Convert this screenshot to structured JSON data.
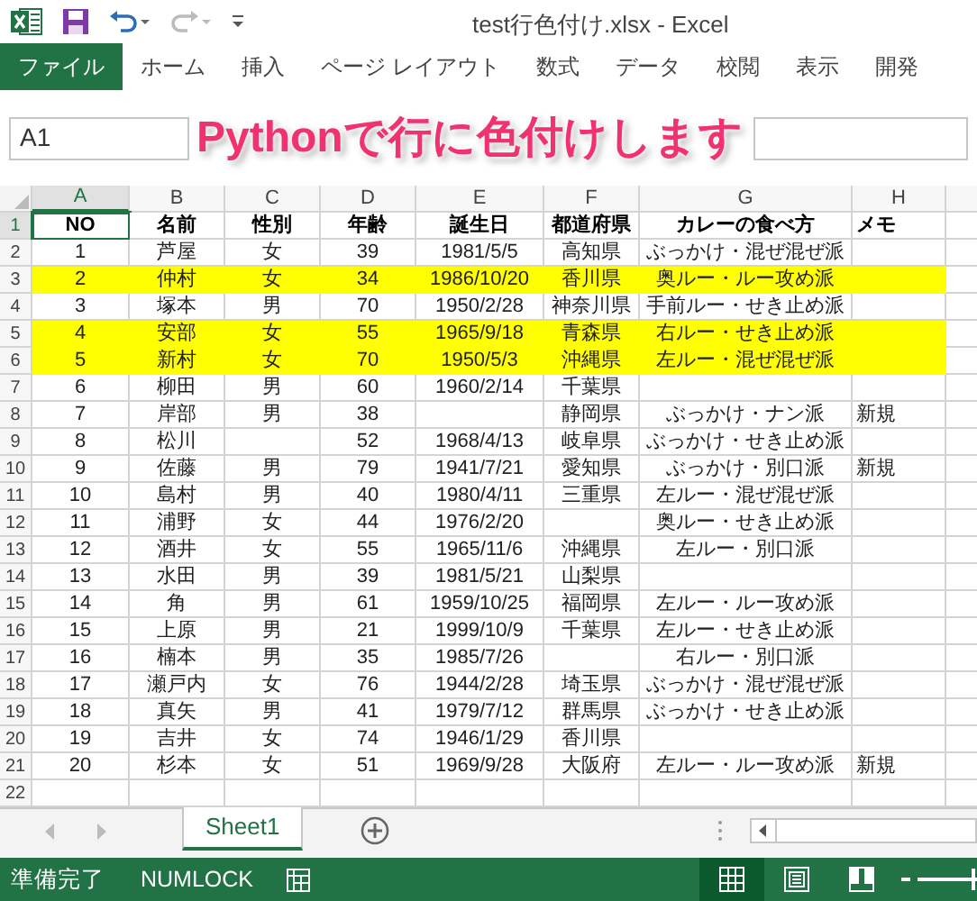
{
  "title_bar": {
    "title": "test行色付け.xlsx - Excel"
  },
  "ribbon_tabs": [
    {
      "label": "ファイル",
      "kind": "file"
    },
    {
      "label": "ホーム",
      "kind": "tab"
    },
    {
      "label": "挿入",
      "kind": "tab"
    },
    {
      "label": "ページ レイアウト",
      "kind": "tab"
    },
    {
      "label": "数式",
      "kind": "tab"
    },
    {
      "label": "データ",
      "kind": "tab"
    },
    {
      "label": "校閲",
      "kind": "tab"
    },
    {
      "label": "表示",
      "kind": "tab"
    },
    {
      "label": "開発",
      "kind": "tab"
    }
  ],
  "name_box": "A1",
  "banner": "Pythonで行に色付けします",
  "columns": [
    {
      "label": "A",
      "selected": true
    },
    {
      "label": "B",
      "selected": false
    },
    {
      "label": "C",
      "selected": false
    },
    {
      "label": "D",
      "selected": false
    },
    {
      "label": "E",
      "selected": false
    },
    {
      "label": "F",
      "selected": false
    },
    {
      "label": "G",
      "selected": false
    },
    {
      "label": "H",
      "selected": false
    }
  ],
  "rows": [
    {
      "number": "1",
      "selected": true,
      "kind": "header",
      "highlighted": false,
      "cells": [
        "NO",
        "名前",
        "性別",
        "年齢",
        "誕生日",
        "都道府県",
        "カレーの食べ方",
        "メモ"
      ]
    },
    {
      "number": "2",
      "selected": false,
      "kind": "data",
      "highlighted": false,
      "cells": [
        "1",
        "芦屋",
        "女",
        "39",
        "1981/5/5",
        "高知県",
        "ぶっかけ・混ぜ混ぜ派",
        null
      ]
    },
    {
      "number": "3",
      "selected": false,
      "kind": "data",
      "highlighted": true,
      "cells": [
        "2",
        "仲村",
        "女",
        "34",
        "1986/10/20",
        "香川県",
        "奥ルー・ルー攻め派",
        null
      ]
    },
    {
      "number": "4",
      "selected": false,
      "kind": "data",
      "highlighted": false,
      "cells": [
        "3",
        "塚本",
        "男",
        "70",
        "1950/2/28",
        "神奈川県",
        "手前ルー・せき止め派",
        null
      ]
    },
    {
      "number": "5",
      "selected": false,
      "kind": "data",
      "highlighted": true,
      "cells": [
        "4",
        "安部",
        "女",
        "55",
        "1965/9/18",
        "青森県",
        "右ルー・せき止め派",
        null
      ]
    },
    {
      "number": "6",
      "selected": false,
      "kind": "data",
      "highlighted": true,
      "cells": [
        "5",
        "新村",
        "女",
        "70",
        "1950/5/3",
        "沖縄県",
        "左ルー・混ぜ混ぜ派",
        null
      ]
    },
    {
      "number": "7",
      "selected": false,
      "kind": "data",
      "highlighted": false,
      "cells": [
        "6",
        "柳田",
        "男",
        "60",
        "1960/2/14",
        "千葉県",
        null,
        null
      ]
    },
    {
      "number": "8",
      "selected": false,
      "kind": "data",
      "highlighted": false,
      "cells": [
        "7",
        "岸部",
        "男",
        "38",
        null,
        "静岡県",
        "ぶっかけ・ナン派",
        "新規"
      ]
    },
    {
      "number": "9",
      "selected": false,
      "kind": "data",
      "highlighted": false,
      "cells": [
        "8",
        "松川",
        null,
        "52",
        "1968/4/13",
        "岐阜県",
        "ぶっかけ・せき止め派",
        null
      ]
    },
    {
      "number": "10",
      "selected": false,
      "kind": "data",
      "highlighted": false,
      "cells": [
        "9",
        "佐藤",
        "男",
        "79",
        "1941/7/21",
        "愛知県",
        "ぶっかけ・別口派",
        "新規"
      ]
    },
    {
      "number": "11",
      "selected": false,
      "kind": "data",
      "highlighted": false,
      "cells": [
        "10",
        "島村",
        "男",
        "40",
        "1980/4/11",
        "三重県",
        "左ルー・混ぜ混ぜ派",
        null
      ]
    },
    {
      "number": "12",
      "selected": false,
      "kind": "data",
      "highlighted": false,
      "cells": [
        "11",
        "浦野",
        "女",
        "44",
        "1976/2/20",
        null,
        "奥ルー・せき止め派",
        null
      ]
    },
    {
      "number": "13",
      "selected": false,
      "kind": "data",
      "highlighted": false,
      "cells": [
        "12",
        "酒井",
        "女",
        "55",
        "1965/11/6",
        "沖縄県",
        "左ルー・別口派",
        null
      ]
    },
    {
      "number": "14",
      "selected": false,
      "kind": "data",
      "highlighted": false,
      "cells": [
        "13",
        "水田",
        "男",
        "39",
        "1981/5/21",
        "山梨県",
        null,
        null
      ]
    },
    {
      "number": "15",
      "selected": false,
      "kind": "data",
      "highlighted": false,
      "cells": [
        "14",
        "角",
        "男",
        "61",
        "1959/10/25",
        "福岡県",
        "左ルー・ルー攻め派",
        null
      ]
    },
    {
      "number": "16",
      "selected": false,
      "kind": "data",
      "highlighted": false,
      "cells": [
        "15",
        "上原",
        "男",
        "21",
        "1999/10/9",
        "千葉県",
        "左ルー・せき止め派",
        null
      ]
    },
    {
      "number": "17",
      "selected": false,
      "kind": "data",
      "highlighted": false,
      "cells": [
        "16",
        "楠本",
        "男",
        "35",
        "1985/7/26",
        null,
        "右ルー・別口派",
        null
      ]
    },
    {
      "number": "18",
      "selected": false,
      "kind": "data",
      "highlighted": false,
      "cells": [
        "17",
        "瀬戸内",
        "女",
        "76",
        "1944/2/28",
        "埼玉県",
        "ぶっかけ・混ぜ混ぜ派",
        null
      ]
    },
    {
      "number": "19",
      "selected": false,
      "kind": "data",
      "highlighted": false,
      "cells": [
        "18",
        "真矢",
        "男",
        "41",
        "1979/7/12",
        "群馬県",
        "ぶっかけ・せき止め派",
        null
      ]
    },
    {
      "number": "20",
      "selected": false,
      "kind": "data",
      "highlighted": false,
      "cells": [
        "19",
        "吉井",
        "女",
        "74",
        "1946/1/29",
        "香川県",
        null,
        null
      ]
    },
    {
      "number": "21",
      "selected": false,
      "kind": "data",
      "highlighted": false,
      "cells": [
        "20",
        "杉本",
        "女",
        "51",
        "1969/9/28",
        "大阪府",
        "左ルー・ルー攻め派",
        "新規"
      ]
    },
    {
      "number": "22",
      "selected": false,
      "kind": "data",
      "highlighted": false
    }
  ],
  "sheet_tabs": [
    {
      "label": "Sheet1",
      "selected": true
    }
  ],
  "status_bar": {
    "status": "準備完了",
    "numlock": "NUMLOCK"
  },
  "zoom_slider": {
    "level": 0.95
  },
  "view_buttons": [
    {
      "kind": "normal",
      "selected": true
    },
    {
      "kind": "page_layout",
      "selected": false
    },
    {
      "kind": "page_break",
      "selected": false
    }
  ]
}
